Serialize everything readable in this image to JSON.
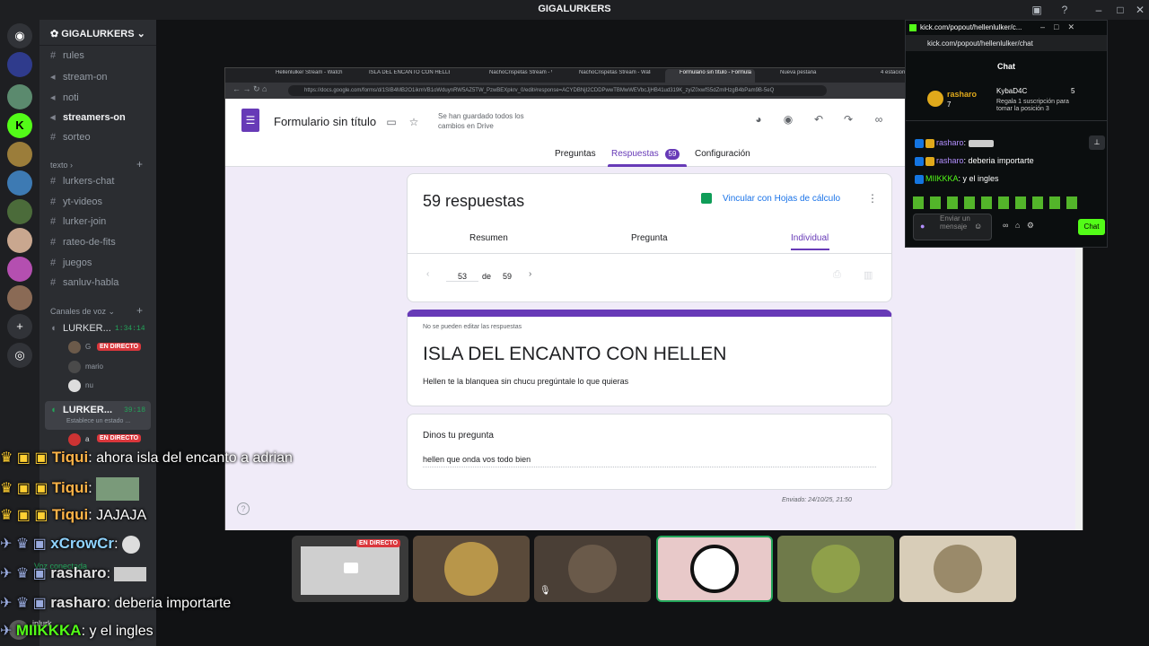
{
  "window": {
    "title": "GIGALURKERS"
  },
  "discord": {
    "server_name": "GIGALURKERS",
    "channels": [
      "rules",
      "stream-on",
      "noti",
      "streamers-on",
      "sorteo"
    ],
    "text_category": "texto",
    "text_channels": [
      "lurkers-chat",
      "yt-videos",
      "lurker-join",
      "rateo-de-fits",
      "juegos",
      "sanluv-habla"
    ],
    "voice_category": "Canales de voz",
    "voice1": {
      "name": "LURKER...",
      "time": "1:34:14",
      "users": [
        "G",
        "mario",
        "nu"
      ],
      "live": "EN DIRECTO"
    },
    "voice2": {
      "name": "LURKER...",
      "time": "39:18",
      "status": "Establece un estado ...",
      "user": "a",
      "live": "EN DIRECTO"
    },
    "voice_connected": "Voz conectada",
    "user": "inlurk"
  },
  "browser": {
    "tabs": [
      "Hellenlulker Stream - Watch",
      "ISLA DEL ENCANTO CON HELLEN",
      "NachoCrispetas Stream - W",
      "NachoCrispetas Stream - Watch",
      "Formulario sin título - Formula",
      "Nueva pestaña",
      "4 estaciones"
    ],
    "url": "https://docs.google.com/forms/d/1SIB4MB2O1ikmVB1oWduynRW5AZ5TW_PzwBEXpkrv_0/edit#response=ACYDBNjI2CDDPwwTBMwWEVbcJjHB41ud319K_zyiZ0xwfS5dZmIHzgB4bPam9B-5eQ"
  },
  "form": {
    "doc_title": "Formulario sin título",
    "save_status": "Se han guardado todos los cambios en Drive",
    "tabs": {
      "preguntas": "Preguntas",
      "respuestas": "Respuestas",
      "count": "59",
      "config": "Configuración"
    },
    "responses_title": "59 respuestas",
    "sheets_link": "Vincular con Hojas de cálculo",
    "subtabs": {
      "resumen": "Resumen",
      "pregunta": "Pregunta",
      "individual": "Individual"
    },
    "pager": {
      "current": "53",
      "de": "de",
      "total": "59"
    },
    "no_edit": "No se pueden editar las respuestas",
    "title": "ISLA DEL ENCANTO CON HELLEN",
    "description": "Hellen te la blanquea sin chucu pregúntale lo que quieras",
    "question": "Dinos tu pregunta",
    "answer": "hellen que onda vos todo bien",
    "sent": "Enviado: 24/10/25, 21:50"
  },
  "tiles": {
    "live": "EN DIRECTO"
  },
  "kick": {
    "url": "kick.com/popout/hellenlulker/c...",
    "address": "kick.com/popout/hellenlulker/chat",
    "header": "Chat",
    "pinned": {
      "name": "rasharo",
      "count": "7",
      "gifter": "KybaD4C",
      "gifter_count": "5",
      "gift_text": "Regala 1 suscripción para tomar la posición 3"
    },
    "messages": [
      {
        "user": "rasharo",
        "text": ""
      },
      {
        "user": "rasharo",
        "text": "deberia importarte"
      },
      {
        "user": "MIIKKKA",
        "text": "y el ingles"
      }
    ],
    "input_placeholder": "Enviar un mensaje",
    "send": "Chat"
  },
  "overlay": [
    {
      "user": "Tiqui",
      "text": "ahora isla del encanto a adrian"
    },
    {
      "user": "Tiqui",
      "text": ""
    },
    {
      "user": "Tiqui",
      "text": "JAJAJA"
    },
    {
      "user": "xCrowCr",
      "text": ""
    },
    {
      "user": "rasharo",
      "text": ""
    },
    {
      "user": "rasharo",
      "text": "deberia importarte"
    },
    {
      "user": "MIIKKKA",
      "text": "y el ingles"
    }
  ],
  "colors": {
    "discord_bg": "#1e1f22",
    "form_purple": "#673ab7",
    "kick_green": "#53fc18",
    "live_red": "#da373c"
  }
}
